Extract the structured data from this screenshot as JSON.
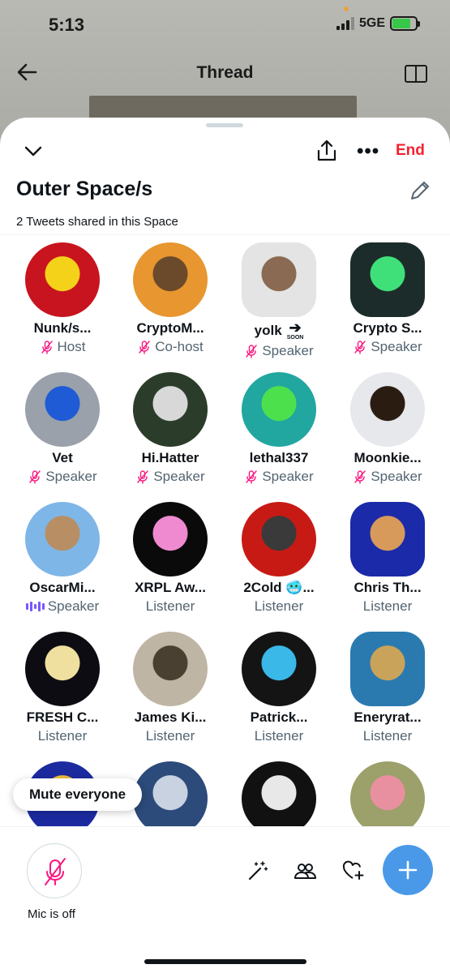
{
  "status_bar": {
    "time": "5:13",
    "network": "5GE"
  },
  "background_header": {
    "title": "Thread"
  },
  "space": {
    "title": "Outer Space/s",
    "end_label": "End",
    "tweets_shared": "2 Tweets shared in this Space"
  },
  "participants": [
    {
      "name": "Nunk/s...",
      "role": "Host",
      "muted": true,
      "colors": [
        "#c8141e",
        "#f4d21a"
      ]
    },
    {
      "name": "CryptoM...",
      "role": "Co-host",
      "muted": true,
      "colors": [
        "#e8962f",
        "#6b4a2b"
      ]
    },
    {
      "name": "yolk",
      "badge": "SOON",
      "role": "Speaker",
      "muted": true,
      "colors": [
        "#e4e4e4",
        "#8a6a52"
      ]
    },
    {
      "name": "Crypto S...",
      "role": "Speaker",
      "muted": true,
      "colors": [
        "#1c2c2a",
        "#3fe07a"
      ]
    },
    {
      "name": "Vet",
      "role": "Speaker",
      "muted": true,
      "colors": [
        "#9aa1ab",
        "#1e5bd4"
      ]
    },
    {
      "name": "Hi.Hatter",
      "role": "Speaker",
      "muted": true,
      "colors": [
        "#2b3d2a",
        "#d8d8d8"
      ]
    },
    {
      "name": "lethal337",
      "role": "Speaker",
      "muted": true,
      "colors": [
        "#21a7a0",
        "#4de04d"
      ]
    },
    {
      "name": "Moonkie...",
      "role": "Speaker",
      "muted": true,
      "colors": [
        "#e6e8ec",
        "#2b1c12"
      ]
    },
    {
      "name": "OscarMi...",
      "role": "Speaker",
      "muted": false,
      "speaking": true,
      "colors": [
        "#7fb6e8",
        "#b88e64"
      ]
    },
    {
      "name": "XRPL Aw...",
      "role": "Listener",
      "muted": false,
      "colors": [
        "#0a0a0a",
        "#f08ad0"
      ]
    },
    {
      "name": "2Cold 🥶...",
      "role": "Listener",
      "muted": false,
      "colors": [
        "#c81a14",
        "#3a3a3a"
      ]
    },
    {
      "name": "Chris Th...",
      "role": "Listener",
      "muted": false,
      "colors": [
        "#1a2aa8",
        "#d89a5a"
      ]
    },
    {
      "name": "FRESH C...",
      "role": "Listener",
      "muted": false,
      "colors": [
        "#0c0c12",
        "#f0e0a0"
      ]
    },
    {
      "name": "James Ki...",
      "role": "Listener",
      "muted": false,
      "colors": [
        "#bfb5a4",
        "#4a4032"
      ]
    },
    {
      "name": "Patrick...",
      "role": "Listener",
      "muted": false,
      "colors": [
        "#141414",
        "#3ab8e8"
      ]
    },
    {
      "name": "Eneryrat...",
      "role": "Listener",
      "muted": false,
      "colors": [
        "#2a7ab0",
        "#caa35a"
      ]
    },
    {
      "name": "",
      "role": "",
      "muted": false,
      "colors": [
        "#1c2aa0",
        "#f0c040"
      ]
    },
    {
      "name": "",
      "role": "",
      "muted": false,
      "colors": [
        "#2c4a7a",
        "#c8d2e0"
      ]
    },
    {
      "name": "",
      "role": "",
      "muted": false,
      "colors": [
        "#111111",
        "#e8e8e8"
      ]
    },
    {
      "name": "",
      "role": "",
      "muted": false,
      "colors": [
        "#9ca06a",
        "#e890a0"
      ]
    }
  ],
  "toast": {
    "label": "Mute everyone"
  },
  "bottom_bar": {
    "mic_label": "Mic is off"
  },
  "colors": {
    "end": "#f4212e",
    "accent": "#4a99e9",
    "mic_off": "#f91880",
    "speaking": "#7856ff"
  }
}
